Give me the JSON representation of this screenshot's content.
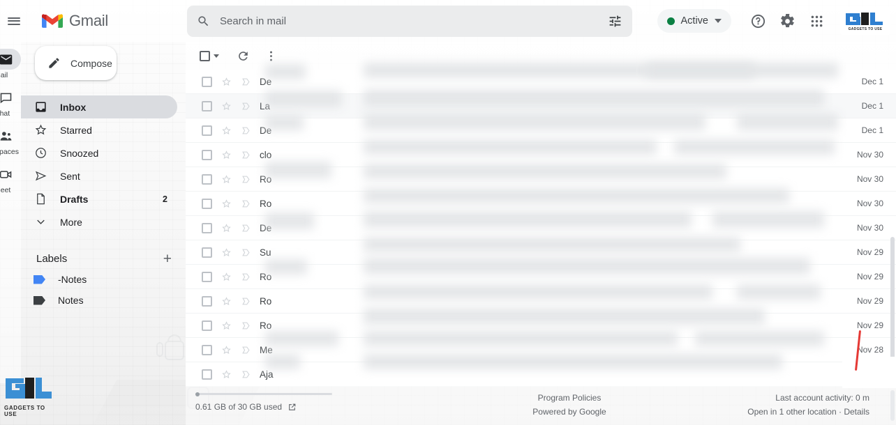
{
  "header": {
    "menu_icon": "hamburger-menu-icon",
    "app_name": "Gmail",
    "logo_icon": "gmail-logo-icon"
  },
  "search": {
    "placeholder": "Search in mail",
    "value": "",
    "search_icon": "search-icon",
    "options_icon": "tune-filter-icon"
  },
  "account_bar": {
    "status_label": "Active",
    "status_color": "#0b8043",
    "status_caret_icon": "chevron-down-icon",
    "help_icon": "help-circle-icon",
    "settings_icon": "gear-icon",
    "apps_icon": "apps-grid-icon",
    "brand_logo_text": "GADGETS TO USE"
  },
  "rail": {
    "items": [
      {
        "label": "Mail",
        "icon": "mail-icon",
        "active": true
      },
      {
        "label": "Chat",
        "icon": "chat-icon",
        "active": false
      },
      {
        "label": "Spaces",
        "icon": "spaces-icon",
        "active": false
      },
      {
        "label": "Meet",
        "icon": "meet-camera-icon",
        "active": false
      }
    ]
  },
  "sidebar": {
    "compose_label": "Compose",
    "compose_icon": "pencil-icon",
    "nav_items": [
      {
        "label": "Inbox",
        "icon": "inbox-icon",
        "count": "",
        "active": true
      },
      {
        "label": "Starred",
        "icon": "star-icon",
        "count": "",
        "active": false
      },
      {
        "label": "Snoozed",
        "icon": "clock-icon",
        "count": "",
        "active": false
      },
      {
        "label": "Sent",
        "icon": "send-icon",
        "count": "",
        "active": false
      },
      {
        "label": "Drafts",
        "icon": "draft-icon",
        "count": "2",
        "active": false
      },
      {
        "label": "More",
        "icon": "chevron-down-icon",
        "count": "",
        "active": false
      }
    ],
    "labels_title": "Labels",
    "labels_add_icon": "plus-icon",
    "labels": [
      {
        "label": "-Notes",
        "color": "#4285f4"
      },
      {
        "label": "Notes",
        "color": "#3c4043"
      }
    ]
  },
  "list_toolbar": {
    "select_all_icon": "checkbox-icon",
    "select_caret_icon": "chevron-down-icon",
    "refresh_icon": "refresh-icon",
    "more_icon": "more-vertical-icon"
  },
  "mail_list": {
    "rows": [
      {
        "sender": "De",
        "date": "Dec 1",
        "hover": false
      },
      {
        "sender": "La",
        "date": "Dec 1",
        "hover": true
      },
      {
        "sender": "De",
        "date": "Dec 1",
        "hover": false
      },
      {
        "sender": "clo",
        "date": "Nov 30",
        "hover": false
      },
      {
        "sender": "Ro",
        "date": "Nov 30",
        "hover": false
      },
      {
        "sender": "Ro",
        "date": "Nov 30",
        "hover": false
      },
      {
        "sender": "De",
        "date": "Nov 30",
        "hover": false
      },
      {
        "sender": "Su",
        "date": "Nov 29",
        "hover": false
      },
      {
        "sender": "Ro",
        "date": "Nov 29",
        "hover": false
      },
      {
        "sender": "Ro",
        "date": "Nov 29",
        "hover": false
      },
      {
        "sender": "Ro",
        "date": "Nov 29",
        "hover": false
      },
      {
        "sender": "Me",
        "date": "Nov 28",
        "hover": false
      },
      {
        "sender": "Aja",
        "date": "",
        "hover": false
      }
    ]
  },
  "footer": {
    "storage_text": "0.61 GB of 30 GB used",
    "storage_link_icon": "external-link-icon",
    "program_policies": "Program Policies",
    "powered_by": "Powered by Google",
    "last_activity": "Last account activity: 0 m",
    "open_location": "Open in 1 other location · Details"
  },
  "watermark": {
    "text": "GADGETS TO USE",
    "color": "#3b8fd4"
  }
}
